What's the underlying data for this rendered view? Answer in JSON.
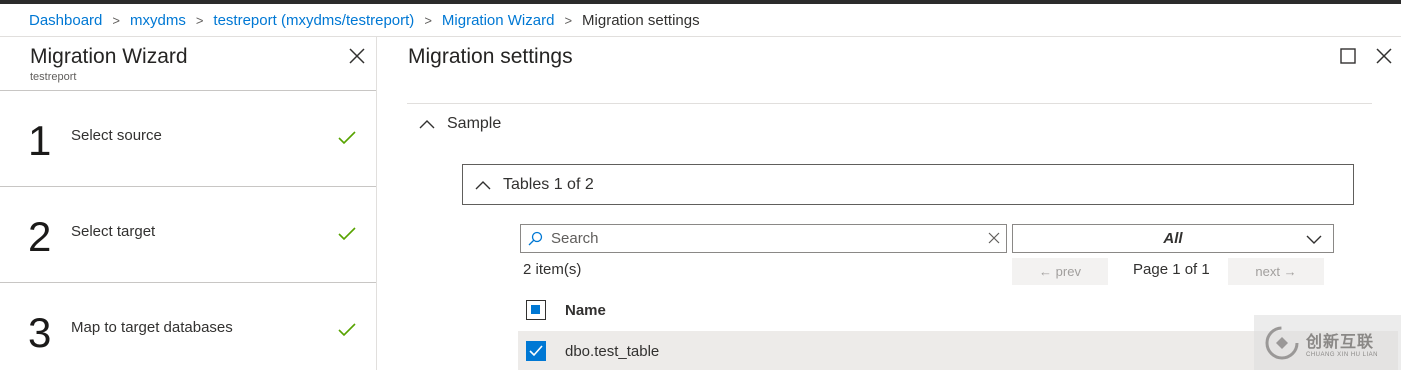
{
  "breadcrumb": {
    "items": [
      "Dashboard",
      "mxydms",
      "testreport (mxydms/testreport)",
      "Migration Wizard"
    ],
    "current": "Migration settings"
  },
  "wizard": {
    "title": "Migration Wizard",
    "subtitle": "testreport",
    "steps": [
      {
        "number": "1",
        "label": "Select source",
        "status": "complete"
      },
      {
        "number": "2",
        "label": "Select target",
        "status": "complete"
      },
      {
        "number": "3",
        "label": "Map to target databases",
        "status": "complete"
      }
    ]
  },
  "main": {
    "title": "Migration settings",
    "section_label": "Sample",
    "tables_label": "Tables 1 of 2",
    "search": {
      "placeholder": "Search",
      "value": ""
    },
    "filter": {
      "selected": "All"
    },
    "item_count": "2 item(s)",
    "pagination": {
      "prev_label": "← prev",
      "page_info": "Page 1 of 1",
      "next_label": "next →"
    },
    "table": {
      "columns": [
        "Name"
      ],
      "rows": [
        {
          "name": "dbo.test_table",
          "checked": true
        }
      ]
    }
  },
  "watermark": {
    "text_cn": "创新互联",
    "text_en": "CHUANG XIN HU LIAN"
  },
  "colors": {
    "accent": "#0078d4",
    "check": "#57a300",
    "text": "#323130"
  },
  "icons": {
    "close": "close-icon",
    "maximize": "maximize-icon",
    "check": "check-icon",
    "chevron_up": "chevron-up-icon",
    "chevron_down": "chevron-down-icon",
    "search": "search-icon",
    "clear": "clear-icon"
  }
}
